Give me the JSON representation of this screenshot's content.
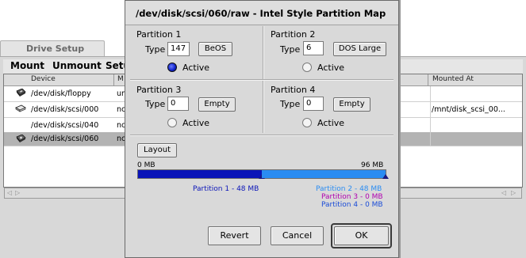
{
  "drive_setup": {
    "tab_label": "Drive Setup",
    "menus": [
      "Mount",
      "Unmount",
      "Setup"
    ],
    "columns": {
      "device": "Device",
      "m": "M",
      "mounted_at": "Mounted At"
    },
    "rows": [
      {
        "device": "/dev/disk/floppy",
        "m": "un",
        "mounted_at": "",
        "icon": "floppy-disk-icon"
      },
      {
        "device": "/dev/disk/scsi/000",
        "m": "nc",
        "mounted_at": "/mnt/disk_scsi_00...",
        "icon": "hard-disk-icon"
      },
      {
        "device": "/dev/disk/scsi/040",
        "m": "nc",
        "mounted_at": "",
        "icon": ""
      },
      {
        "device": "/dev/disk/scsi/060",
        "m": "nc",
        "mounted_at": "",
        "icon": "removable-disk-icon"
      }
    ]
  },
  "dialog": {
    "title": "/dev/disk/scsi/060/raw - Intel Style Partition Map",
    "type_label": "Type",
    "active_label": "Active",
    "partitions": [
      {
        "name": "Partition 1",
        "type": "147",
        "type_button": "BeOS",
        "active": true
      },
      {
        "name": "Partition 2",
        "type": "6",
        "type_button": "DOS Large",
        "active": false
      },
      {
        "name": "Partition 3",
        "type": "0",
        "type_button": "Empty",
        "active": false
      },
      {
        "name": "Partition 4",
        "type": "0",
        "type_button": "Empty",
        "active": false
      }
    ],
    "layout_button": "Layout",
    "bar": {
      "min_label": "0 MB",
      "max_label": "96 MB",
      "total_mb": 96,
      "segments": [
        {
          "label": "Partition 1 - 48 MB",
          "mb": 48,
          "color": "#0a14b8"
        },
        {
          "label": "Partition 2 - 48 MB",
          "mb": 48,
          "color": "#2a8cf2"
        },
        {
          "label": "Partition 3 - 0 MB",
          "mb": 0,
          "color": "#b000b0"
        },
        {
          "label": "Partition 4 - 0 MB",
          "mb": 0,
          "color": "#1a4cd8"
        }
      ]
    },
    "buttons": {
      "revert": "Revert",
      "cancel": "Cancel",
      "ok": "OK"
    }
  }
}
